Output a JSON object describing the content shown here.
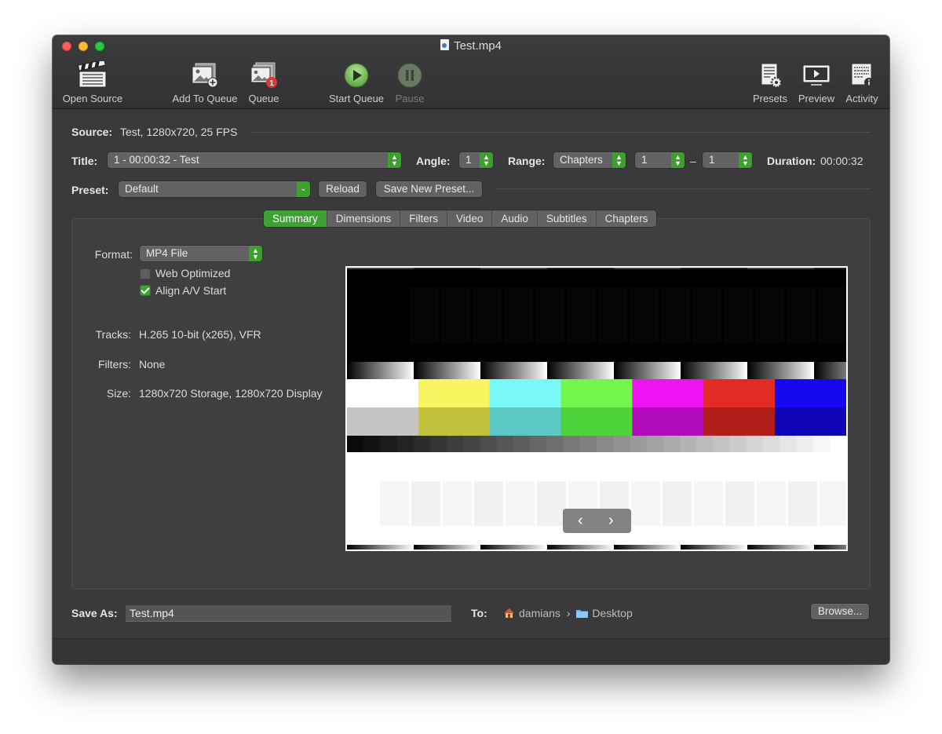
{
  "window": {
    "title": "Test.mp4"
  },
  "toolbar": {
    "open_source": "Open Source",
    "add_to_queue": "Add To Queue",
    "queue": "Queue",
    "queue_badge": "1",
    "start_queue": "Start Queue",
    "pause": "Pause",
    "presets": "Presets",
    "preview": "Preview",
    "activity": "Activity"
  },
  "source": {
    "label": "Source:",
    "value": "Test, 1280x720, 25 FPS"
  },
  "title_row": {
    "title_label": "Title:",
    "title_value": "1 - 00:00:32 - Test",
    "angle_label": "Angle:",
    "angle_value": "1",
    "range_label": "Range:",
    "range_value": "Chapters",
    "range_start": "1",
    "range_dash": "–",
    "range_end": "1",
    "duration_label": "Duration:",
    "duration_value": "00:00:32"
  },
  "preset_row": {
    "preset_label": "Preset:",
    "preset_value": "Default",
    "reload": "Reload",
    "save_new": "Save New Preset..."
  },
  "tabs": [
    "Summary",
    "Dimensions",
    "Filters",
    "Video",
    "Audio",
    "Subtitles",
    "Chapters"
  ],
  "active_tab": "Summary",
  "summary": {
    "format_label": "Format:",
    "format_value": "MP4 File",
    "web_optimized": "Web Optimized",
    "web_optimized_checked": false,
    "align_av": "Align A/V Start",
    "align_av_checked": true,
    "tracks_label": "Tracks:",
    "tracks_value": "H.265 10-bit (x265), VFR",
    "filters_label": "Filters:",
    "filters_value": "None",
    "size_label": "Size:",
    "size_value": "1280x720 Storage, 1280x720 Display",
    "prev_arrow": "‹",
    "next_arrow": "›"
  },
  "save_as": {
    "label": "Save As:",
    "value": "Test.mp4",
    "to_label": "To:",
    "path_user": "damians",
    "path_sep": "›",
    "path_folder": "Desktop",
    "browse": "Browse..."
  },
  "colors": {
    "accent_green": "#3fa033",
    "window_bg": "#3a3a3c",
    "badge_red": "#e0382f"
  }
}
